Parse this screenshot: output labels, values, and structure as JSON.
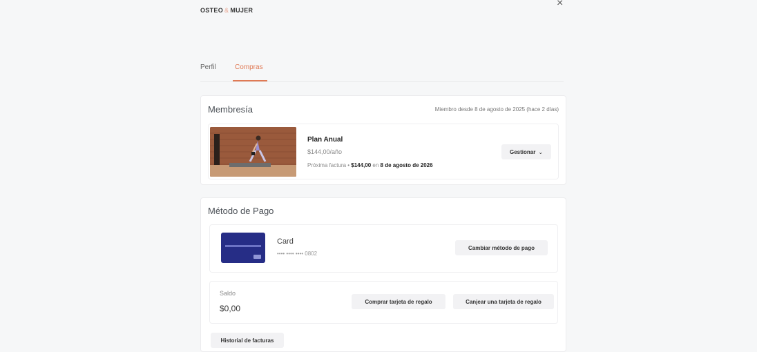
{
  "brand": {
    "part1": "OSTEO",
    "amp": "&",
    "part2": "MUJER"
  },
  "close_icon": "×",
  "tabs": [
    {
      "label": "Perfil"
    },
    {
      "label": "Compras"
    }
  ],
  "accent_color": "#e07a55",
  "membership": {
    "title": "Membresía",
    "since": "Miembro desde 8 de agosto de 2025 (hace 2 días)",
    "plan": {
      "name": "Plan Anual",
      "price": "$144,00/año",
      "next_prefix": "Próxima factura • ",
      "next_amount": "$144,00",
      "next_mid": " en ",
      "next_date": "8 de agosto de 2026"
    },
    "manage_label": "Gestionar",
    "manage_chevron": "⌄"
  },
  "payment": {
    "title": "Método de Pago",
    "card_name": "Card",
    "card_number": "•••• •••• •••• 0802",
    "change_label": "Cambiar método de pago"
  },
  "balance": {
    "label": "Saldo",
    "value": "$0,00",
    "buy_gift_label": "Comprar tarjeta de regalo",
    "redeem_gift_label": "Canjear una tarjeta de regalo"
  },
  "invoices_label": "Historial de facturas"
}
